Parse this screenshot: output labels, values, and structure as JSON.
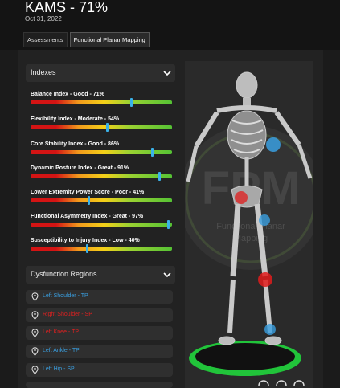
{
  "header": {
    "title": "KAMS - 71%",
    "date": "Oct 31, 2022"
  },
  "tabs": [
    {
      "label": "Assessments",
      "active": false
    },
    {
      "label": "Functional Planar Mapping",
      "active": true
    }
  ],
  "indexes_panel": {
    "title": "Indexes",
    "items": [
      {
        "label": "Balance Index - Good - 71%",
        "level": 0.71
      },
      {
        "label": "Flexibility Index - Moderate - 54%",
        "level": 0.54
      },
      {
        "label": "Core Stability Index - Good - 86%",
        "level": 0.86
      },
      {
        "label": "Dynamic Posture Index - Great - 91%",
        "level": 0.91
      },
      {
        "label": "Lower Extremity Power Score - Poor - 41%",
        "level": 0.41
      },
      {
        "label": "Functional Asymmetry Index - Great - 97%",
        "level": 0.97
      },
      {
        "label": "Susceptibility to Injury Index - Low - 40%",
        "level": 0.4
      }
    ]
  },
  "dysfunction_panel": {
    "title": "Dysfunction Regions",
    "items": [
      {
        "label": "Left Shoulder - TP",
        "color": "#3a9fe0"
      },
      {
        "label": "Right Shoulder - SP",
        "color": "#e02020"
      },
      {
        "label": "Left Knee - TP",
        "color": "#e02020"
      },
      {
        "label": "Left Ankle - TP",
        "color": "#3a9fe0"
      },
      {
        "label": "Left Hip - SP",
        "color": "#3a9fe0"
      }
    ]
  },
  "viewer": {
    "watermark_title": "FPM",
    "watermark_subtitle_1": "Functional Planar",
    "watermark_subtitle_2": "Mapping"
  },
  "colors": {
    "marker": "#3ab2e8",
    "platform_ring": "#21c43a",
    "hotspot_red": "#e01c1c",
    "hotspot_blue": "#3a9fe0"
  }
}
